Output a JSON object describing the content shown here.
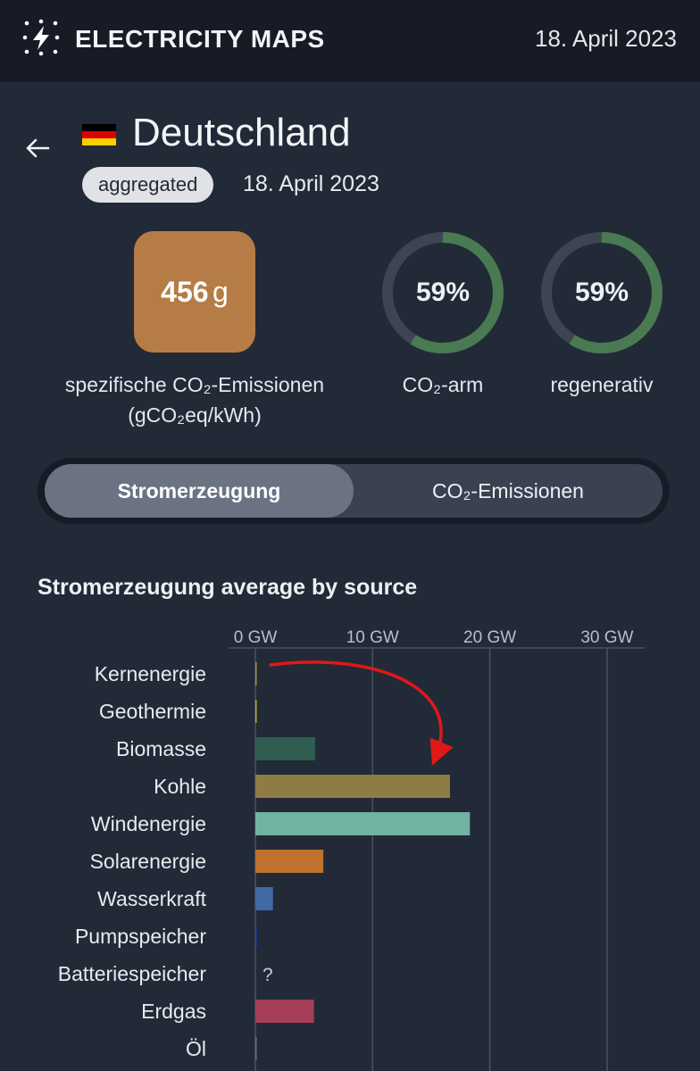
{
  "header": {
    "app_title": "ELECTRICITY MAPS",
    "date": "18. April 2023",
    "logo_icon": "lightning-bolt-icon"
  },
  "zone": {
    "back_icon": "arrow-left-icon",
    "flag_icon": "germany-flag-icon",
    "name": "Deutschland",
    "badge": "aggregated",
    "date": "18. April 2023"
  },
  "metrics": {
    "co2_value": "456",
    "co2_unit": "g",
    "co2_label_line1": "spezifische CO₂-Emissionen",
    "co2_label_line2": "(gCO₂eq/kWh)",
    "co2_tile_color": "#b67c45",
    "low_carbon_percent": "59%",
    "low_carbon_fraction": 0.59,
    "low_carbon_label": "CO₂-arm",
    "renewable_percent": "59%",
    "renewable_fraction": 0.59,
    "renewable_label": "regenerativ",
    "ring_color": "#4a7a52",
    "ring_track_color": "#3e4552"
  },
  "toggle": {
    "active_label": "Stromerzeugung",
    "other_label": "CO₂-Emissionen"
  },
  "section_title": "Stromerzeugung average by source",
  "chart_data": {
    "type": "bar",
    "orientation": "horizontal",
    "unit": "GW",
    "xlim": [
      0,
      33
    ],
    "x_ticks": [
      0,
      10,
      20,
      30
    ],
    "x_tick_labels": [
      "0 GW",
      "10 GW",
      "20 GW",
      "30 GW"
    ],
    "grid": true,
    "categories": [
      "Kernenergie",
      "Geothermie",
      "Biomasse",
      "Kohle",
      "Windenergie",
      "Solarenergie",
      "Wasserkraft",
      "Pumpspeicher",
      "Batteriespeicher",
      "Erdgas",
      "Öl"
    ],
    "values": [
      0.05,
      0.02,
      5.1,
      16.6,
      18.3,
      5.8,
      1.5,
      0.1,
      null,
      5.0,
      0.1
    ],
    "missing_label": "?",
    "colors": [
      "#9c9348",
      "#b6a640",
      "#2f5d50",
      "#8f7c45",
      "#71b2a3",
      "#c0702f",
      "#3f6aa3",
      "#243fa0",
      "#888888",
      "#a53f58",
      "#6f6f6f"
    ],
    "annotation": "red arrow from Kernenergie to Kohle",
    "annotation_color": "#e01818"
  }
}
